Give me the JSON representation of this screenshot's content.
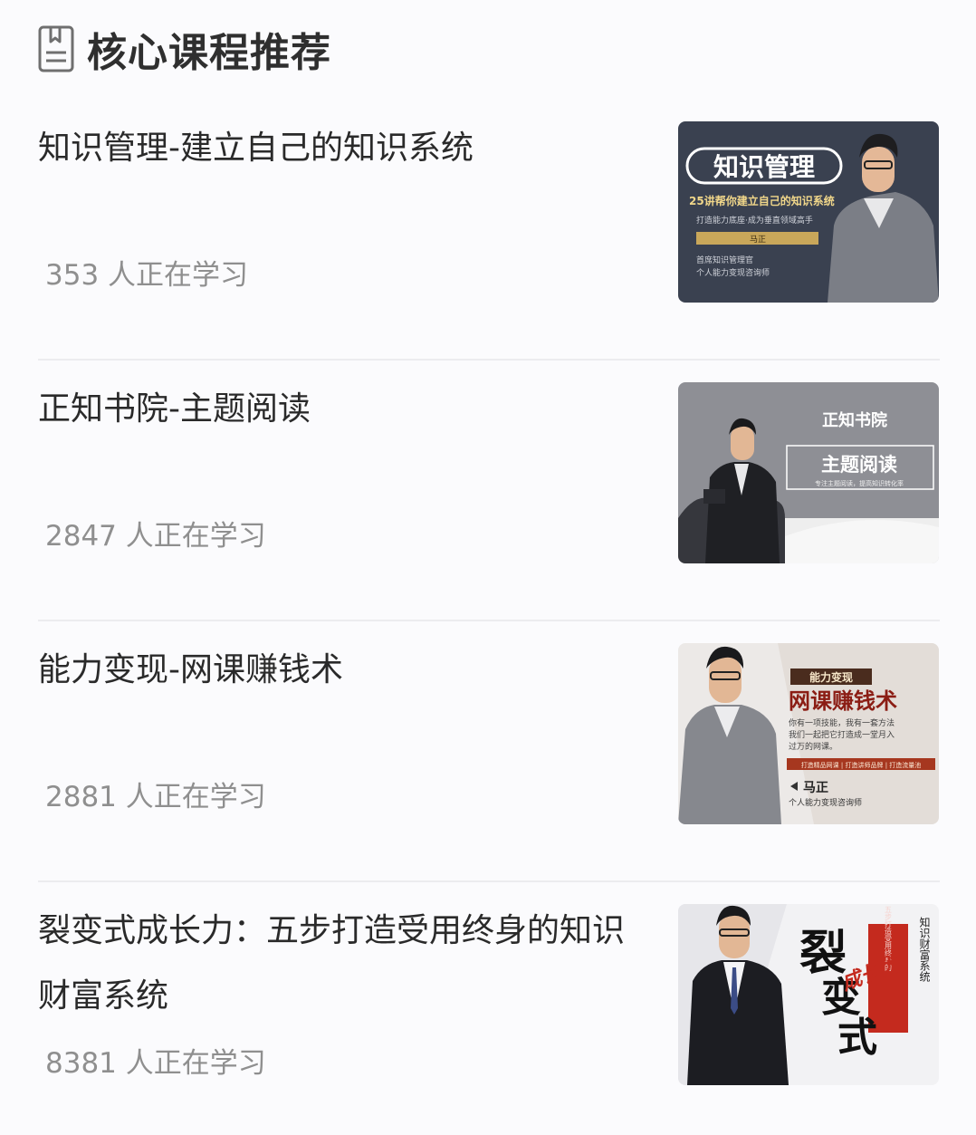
{
  "header": {
    "title": "核心课程推荐",
    "icon": "document-icon"
  },
  "courses": [
    {
      "name": "知识管理-建立自己的知识系统",
      "learners": "353 人正在学习",
      "thumb": {
        "title": "知识管理",
        "line1": "25讲帮你建立自己的知识系统",
        "line2": "打造能力底座·成为垂直领域高手",
        "author": "马正",
        "line3": "首席知识管理官",
        "line4": "个人能力变现咨询师",
        "bg": "#3a4150"
      }
    },
    {
      "name": "正知书院-主题阅读",
      "learners": "2847 人正在学习",
      "thumb": {
        "title": "正知书院",
        "subtitle": "主题阅读",
        "line1": "专注主题阅读，提高知识转化率",
        "bg": "#8e8f95"
      }
    },
    {
      "name": "能力变现-网课赚钱术",
      "learners": "2881 人正在学习",
      "thumb": {
        "tag": "能力变现",
        "title": "网课赚钱术",
        "line1": "你有一项技能，我有一套方法",
        "line2": "我们一起把它打造成一堂月入",
        "line3": "过万的网课。",
        "strip": "打造精品网课 | 打造讲师品牌 | 打造流量池",
        "author": "马正",
        "line4": "个人能力变现咨询师",
        "bg": "#ece9e7"
      }
    },
    {
      "name": "裂变式成长力：五步打造受用终身的知识财富系统",
      "learners": "8381 人正在学习",
      "thumb": {
        "title_a": "裂",
        "title_b": "变",
        "title_c": "式",
        "accent": "成长力",
        "red_text": "五步打造受用终身的",
        "side_text": "知识财富系统",
        "bg": "#f2f2f4"
      }
    }
  ]
}
